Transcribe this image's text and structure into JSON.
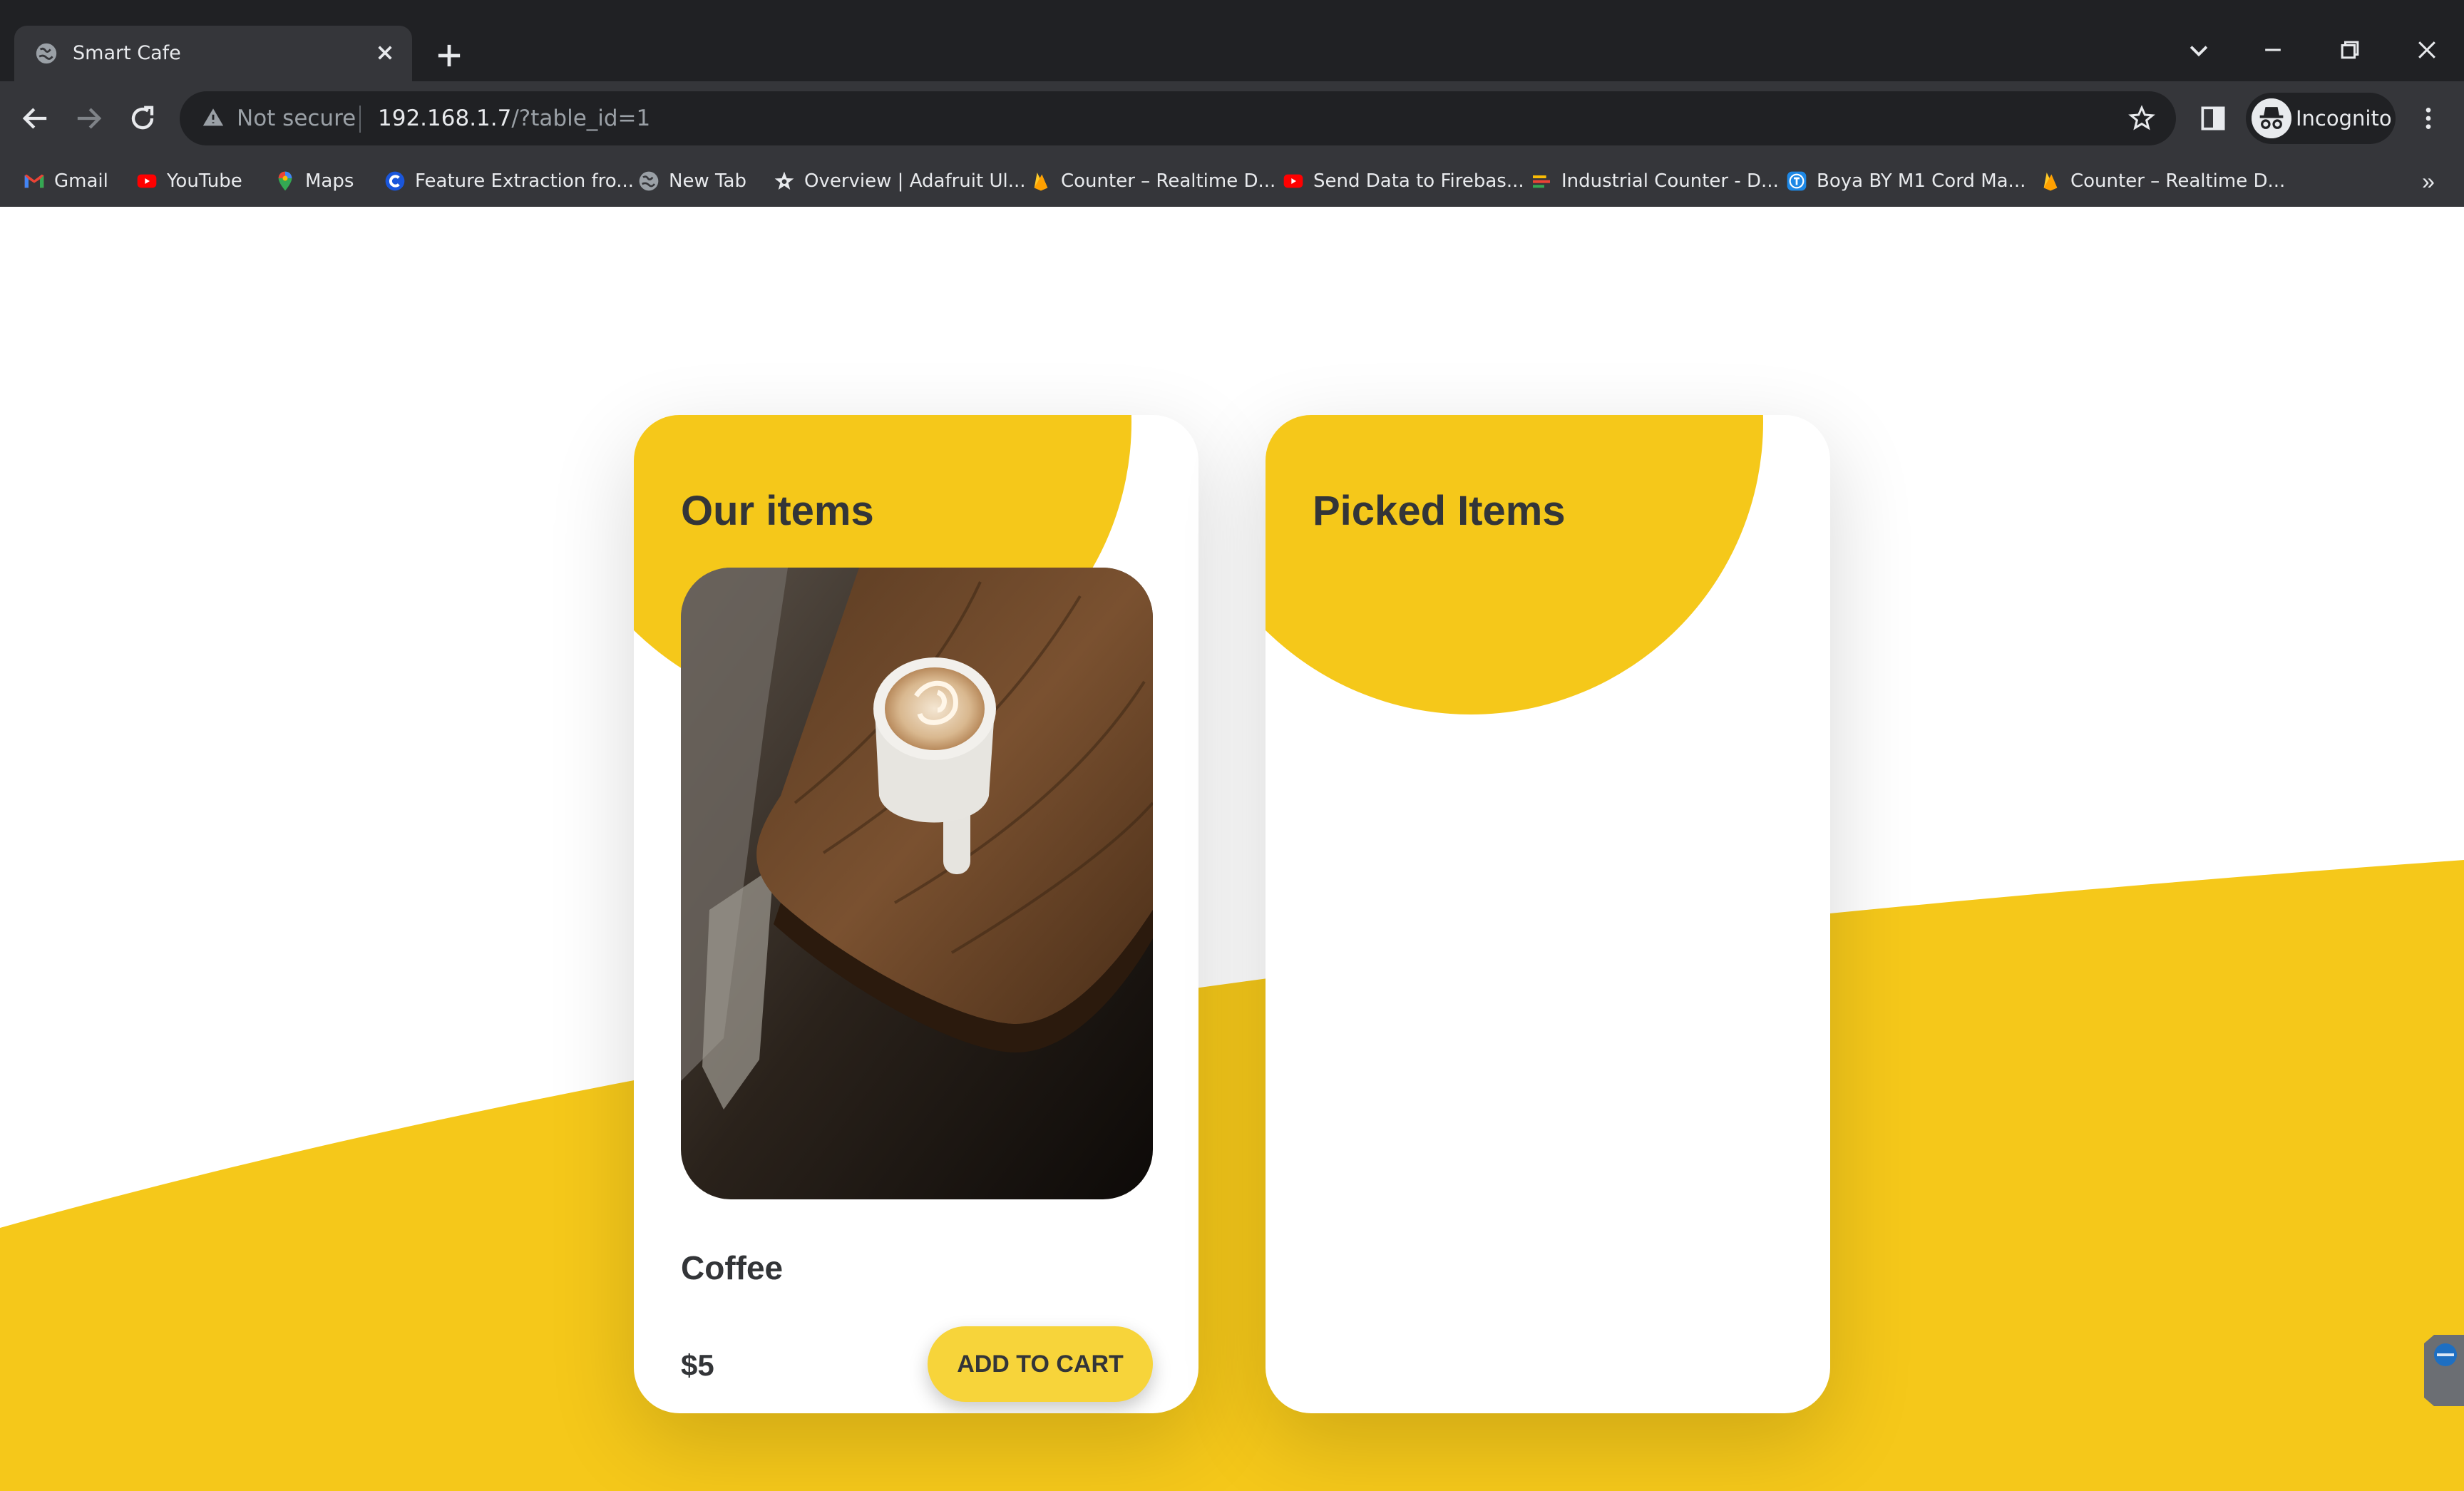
{
  "browser": {
    "tab_title": "Smart Cafe",
    "omnibox": {
      "security_label": "Not secure",
      "url_host": "192.168.1.7",
      "url_path": "/?table_id=1"
    },
    "profile_label": "Incognito",
    "bookmarks": [
      {
        "label": "Gmail",
        "icon": "gmail-icon"
      },
      {
        "label": "YouTube",
        "icon": "youtube-icon"
      },
      {
        "label": "Maps",
        "icon": "maps-icon"
      },
      {
        "label": "Feature Extraction fro...",
        "icon": "c-logo-icon"
      },
      {
        "label": "New Tab",
        "icon": "globe-icon"
      },
      {
        "label": "Overview | Adafruit Ul...",
        "icon": "adafruit-star-icon"
      },
      {
        "label": "Counter – Realtime D...",
        "icon": "firebase-icon"
      },
      {
        "label": "Send Data to Firebas...",
        "icon": "youtube-icon"
      },
      {
        "label": "Industrial Counter - D...",
        "icon": "bars-icon"
      },
      {
        "label": "Boya BY M1 Cord Ma...",
        "icon": "t-logo-icon"
      },
      {
        "label": "Counter – Realtime D...",
        "icon": "firebase-icon"
      }
    ]
  },
  "colors": {
    "accent_yellow": "#f5c81a",
    "button_yellow": "#f7d43a",
    "text_dark": "#333538"
  },
  "menu_card": {
    "title": "Our items",
    "item": {
      "name": "Coffee",
      "price": "$5",
      "add_button_label": "ADD TO CART"
    }
  },
  "cart_card": {
    "title": "Picked Items"
  }
}
